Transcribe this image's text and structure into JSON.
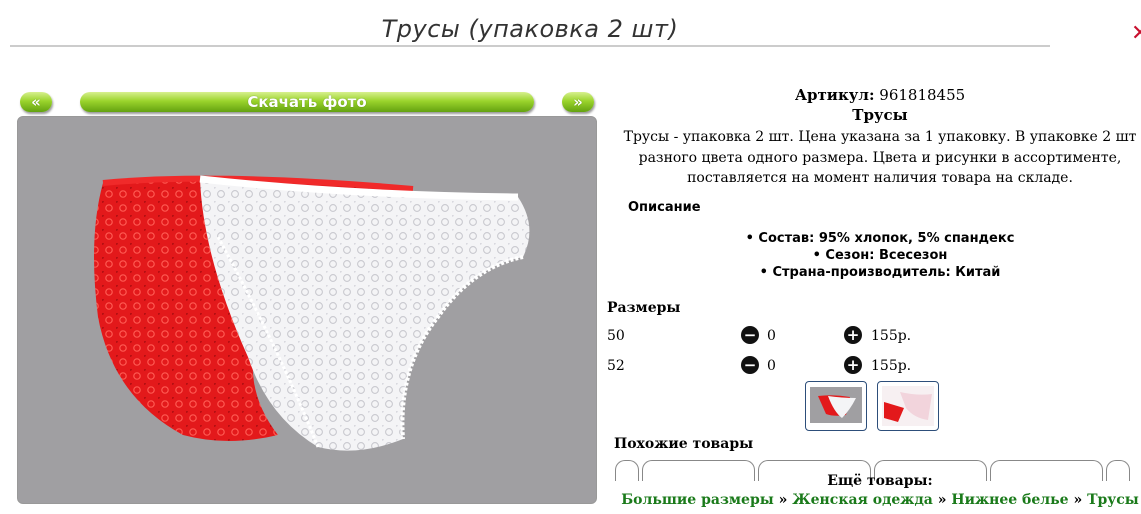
{
  "title": "Трусы (упаковка 2 шт)",
  "gallery": {
    "prev_label": "«",
    "download_label": "Скачать фото",
    "next_label": "»"
  },
  "product": {
    "article_label": "Артикул:",
    "article_value": "961818455",
    "name": "Трусы",
    "description": "Трусы - упаковка 2 шт. Цена указана за 1 упаковку. В упаковке 2 шт разного цвета одного размера. Цвета и рисунки в ассортименте, поставляется на момент наличия товара на складе.",
    "spec_heading": "Описание",
    "specs": [
      "Состав: 95% хлопок, 5% спандекс",
      "Сезон: Всесезон",
      "Страна-производитель: Китай"
    ]
  },
  "sizes": {
    "heading": "Размеры",
    "rows": [
      {
        "size": "50",
        "qty": "0",
        "price": "155р."
      },
      {
        "size": "52",
        "qty": "0",
        "price": "155р."
      }
    ]
  },
  "icons": {
    "minus": "minus-circle-icon",
    "plus": "plus-circle-icon"
  },
  "similar_heading": "Похожие товары",
  "more_heading": "Ещё товары:",
  "breadcrumbs": [
    "Большие размеры",
    "Женская одежда",
    "Нижнее белье",
    "Трусы"
  ],
  "breadcrumb_separator": "»",
  "colors": {
    "accent_green": "#9bd42c",
    "link_green": "#1a7a1a",
    "product_red": "#e01818",
    "photo_bg": "#a09fa2"
  }
}
